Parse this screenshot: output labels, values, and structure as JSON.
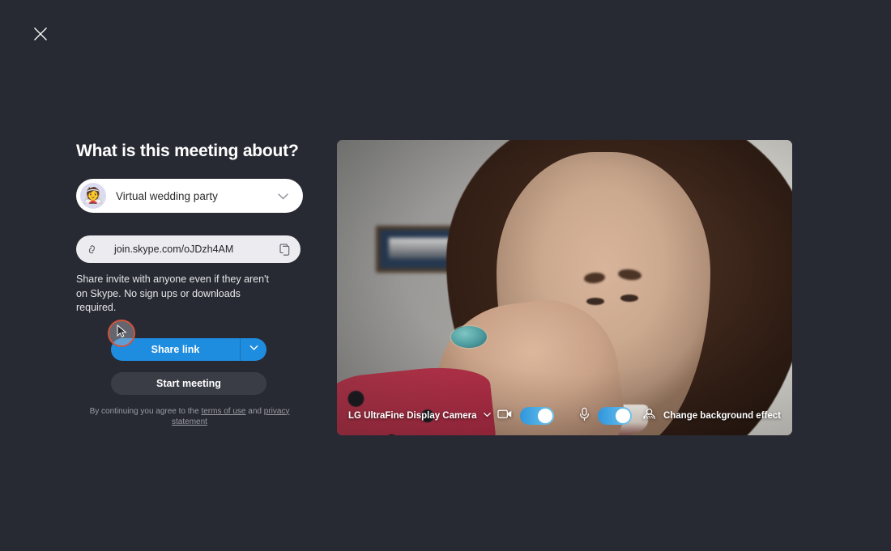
{
  "window": {
    "background_color": "#282a33",
    "close_label": "Close"
  },
  "left_panel": {
    "title": "What is this meeting about?",
    "topic_field": {
      "value": "Virtual wedding party",
      "avatar_icon": "bride-with-veil-emoji",
      "avatar_glyph": "👰",
      "chevron_icon": "chevron-down-icon"
    },
    "link_field": {
      "value": "join.skype.com/oJDzh4AM",
      "link_icon": "chain-link-icon",
      "copy_icon": "copy-icon"
    },
    "share_description": "Share invite with anyone even if they aren't on Skype. No sign ups or downloads required.",
    "share_button": {
      "label": "Share link",
      "color": "#1e8cdf",
      "caret_icon": "chevron-down-icon"
    },
    "start_button": {
      "label": "Start meeting",
      "color": "#3b3d46"
    },
    "legal": {
      "prefix": "By continuing you agree to the ",
      "terms_label": "terms of use",
      "middle": " and ",
      "privacy_label": "privacy statement"
    },
    "cursor": {
      "highlight_color": "#d2543c",
      "icon": "mouse-pointer-icon"
    }
  },
  "video_preview": {
    "camera_label": "LG UltraFine Display Camera",
    "camera_chevron_icon": "chevron-down-icon",
    "camera_toggle": {
      "icon": "video-camera-icon",
      "state": "on",
      "accent_color": "#2f96dc"
    },
    "mic_toggle": {
      "icon": "microphone-icon",
      "state": "on",
      "accent_color": "#2f96dc"
    },
    "background_effect": {
      "label": "Change background effect",
      "icon": "blur-background-icon"
    }
  }
}
